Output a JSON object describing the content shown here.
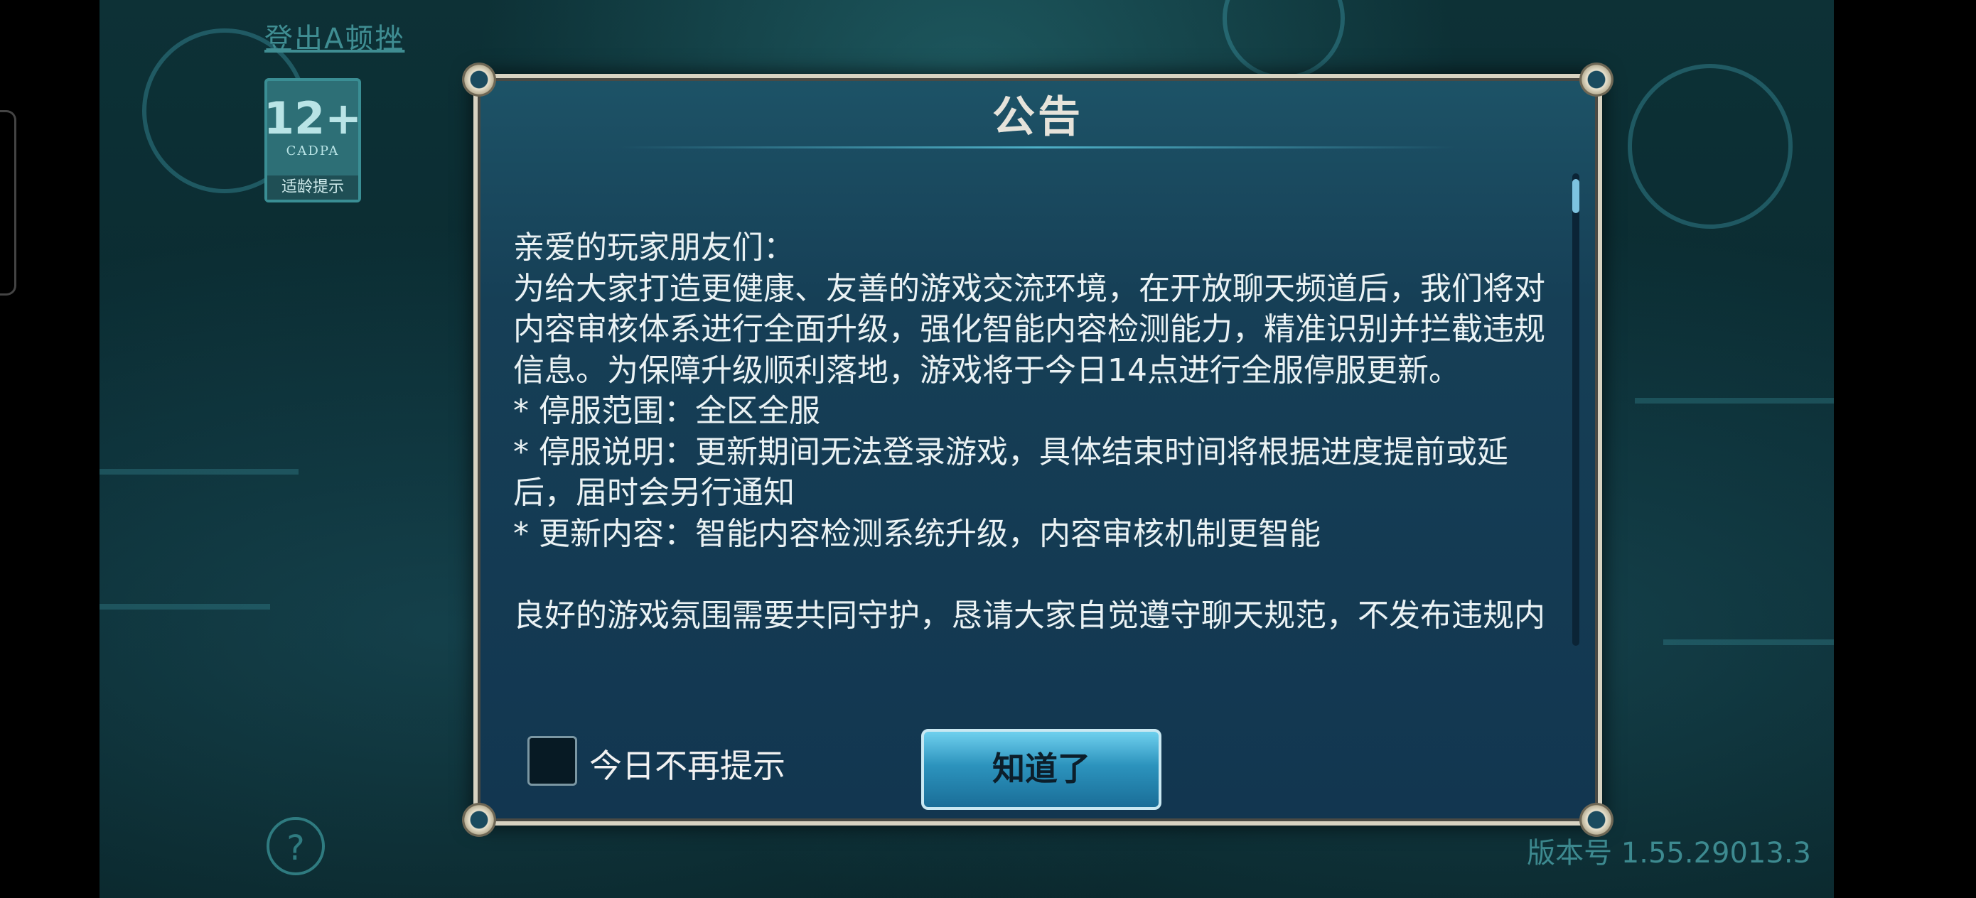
{
  "hud": {
    "logout_text": "登出A顿挫",
    "age_rating": "12+",
    "age_org": "CADPA",
    "age_tip": "适龄提示",
    "help_symbol": "?",
    "version": "版本号 1.55.29013.3"
  },
  "dialog": {
    "title": "公告",
    "paragraphs": [
      "亲爱的玩家朋友们：",
      "为给大家打造更健康、友善的游戏交流环境，在开放聊天频道后，我们将对内容审核体系进行全面升级，强化智能内容检测能力，精准识别并拦截违规信息。为保障升级顺利落地，游戏将于今日14点进行全服停服更新。",
      "* 停服范围：全区全服",
      "* 停服说明：更新期间无法登录游戏，具体结束时间将根据进度提前或延后，届时会另行通知",
      "* 更新内容：智能内容检测系统升级，内容审核机制更智能",
      "",
      "良好的游戏氛围需要共同守护，恳请大家自觉遵守聊天规范，不发布违规内容，同时积极参与监督，遇不良信息及时举报。让我们携手共建文"
    ],
    "checkbox_label": "今日不再提示",
    "checkbox_checked": false,
    "ok_button": "知道了"
  },
  "colors": {
    "dialog_bg": "#163f56",
    "button_accent": "#2c93bd",
    "hud_teal": "#3f8d92"
  }
}
